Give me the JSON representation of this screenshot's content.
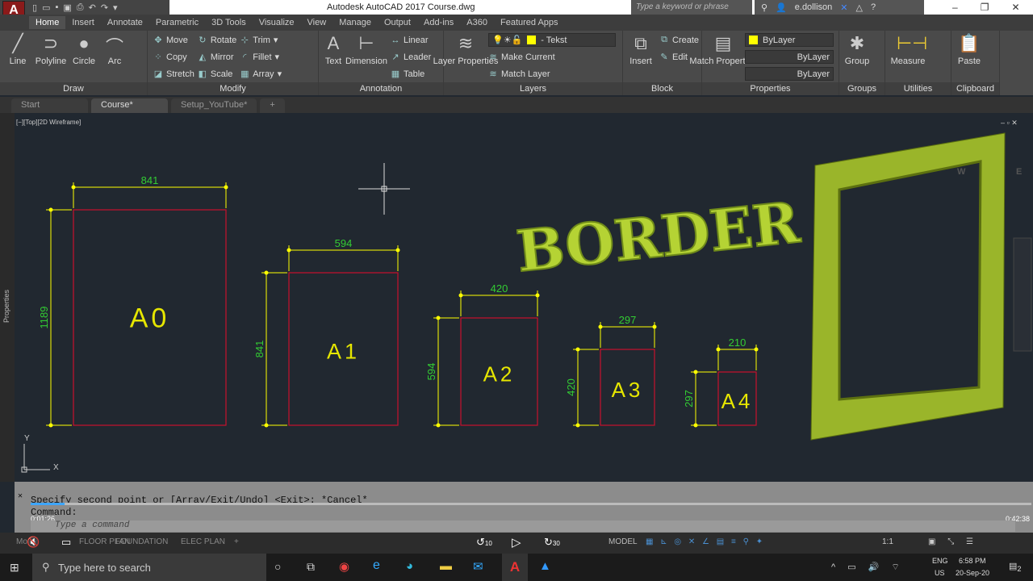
{
  "titlebar": {
    "title": "Autodesk AutoCAD 2017    Course.dwg",
    "search_placeholder": "Type a keyword or phrase",
    "user": "e.dollison"
  },
  "ribbon_tabs": [
    "Home",
    "Insert",
    "Annotate",
    "Parametric",
    "3D Tools",
    "Visualize",
    "View",
    "Manage",
    "Output",
    "Add-ins",
    "A360",
    "Featured Apps"
  ],
  "draw": {
    "title": "Draw",
    "line": "Line",
    "polyline": "Polyline",
    "circle": "Circle",
    "arc": "Arc"
  },
  "modify": {
    "title": "Modify",
    "move": "Move",
    "rotate": "Rotate",
    "trim": "Trim",
    "copy": "Copy",
    "mirror": "Mirror",
    "fillet": "Fillet",
    "stretch": "Stretch",
    "scale": "Scale",
    "array": "Array"
  },
  "annotation": {
    "title": "Annotation",
    "text": "Text",
    "dimension": "Dimension",
    "linear": "Linear",
    "leader": "Leader",
    "table": "Table"
  },
  "layers": {
    "title": "Layers",
    "layer_properties": "Layer Properties",
    "current_layer": "- Tekst",
    "make_current": "Make Current",
    "match_layer": "Match Layer"
  },
  "block": {
    "title": "Block",
    "insert": "Insert",
    "create": "Create",
    "edit": "Edit"
  },
  "properties": {
    "title": "Properties",
    "match": "Match Properties",
    "color": "ByLayer",
    "linetype": "ByLayer",
    "lineweight": "ByLayer"
  },
  "groups": {
    "title": "Groups",
    "group": "Group"
  },
  "utilities": {
    "title": "Utilities",
    "measure": "Measure"
  },
  "clipboard": {
    "title": "Clipboard",
    "paste": "Paste"
  },
  "file_tabs": [
    "Start",
    "Course*",
    "Setup_YouTube*"
  ],
  "viewport_label": "[−][Top][2D Wireframe]",
  "side_palette": "Properties",
  "drawing": {
    "sheets": [
      {
        "name": "A0",
        "width": "841",
        "height": "1189"
      },
      {
        "name": "A1",
        "width": "594",
        "height": "841"
      },
      {
        "name": "A2",
        "width": "420",
        "height": "594"
      },
      {
        "name": "A3",
        "width": "297",
        "height": "420"
      },
      {
        "name": "A4",
        "width": "210",
        "height": "297"
      }
    ],
    "border_text": "BORDER",
    "colors": {
      "background": "#212830",
      "frame": "#c8102e",
      "dimension": "#ffff00",
      "dim_text": "#33cc33",
      "sheet_label": "#e6e600",
      "border_text": "#b5d334"
    }
  },
  "command": {
    "history1": "Specify second point or [Array/Exit/Undo] <Exit>: *Cancel*",
    "history2": "Command:",
    "placeholder": "Type a command"
  },
  "video": {
    "current": "0:01:26",
    "duration": "0:42:38",
    "progress_fraction": 0.034,
    "rewind": "10",
    "forward": "30"
  },
  "layout_tabs": [
    "Model",
    "FLOOR PLAN",
    "FOUNDATION",
    "ELEC PLAN"
  ],
  "status": {
    "model": "MODEL",
    "scale": "1:1"
  },
  "taskbar": {
    "search": "Type here to search",
    "lang1": "ENG",
    "lang2": "US",
    "time": "6:58 PM",
    "date": "20-Sep-20",
    "notifications": "2"
  }
}
